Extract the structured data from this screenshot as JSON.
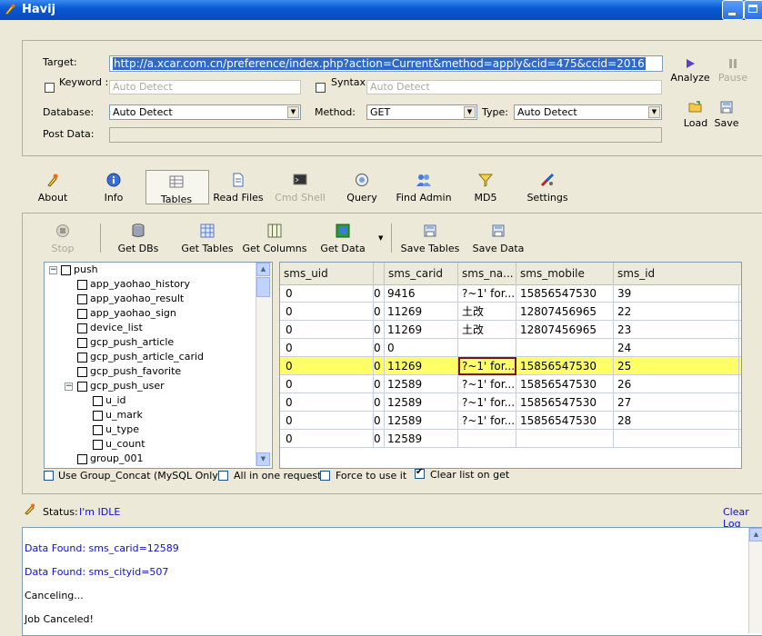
{
  "window": {
    "title": "Havij"
  },
  "target": {
    "target_label": "Target:",
    "url": "http://a.xcar.com.cn/preference/index.php?action=Current&method=apply&cid=475&ccid=2016",
    "keyword_label": "Keyword :",
    "keyword_placeholder": "Auto Detect",
    "syntax_label": "Syntax :",
    "syntax_placeholder": "Auto Detect",
    "database_label": "Database:",
    "database_value": "Auto Detect",
    "method_label": "Method:",
    "method_value": "GET",
    "type_label": "Type:",
    "type_value": "Auto Detect",
    "post_label": "Post Data:"
  },
  "side_buttons": {
    "analyze": "Analyze",
    "pause": "Pause",
    "load": "Load",
    "save": "Save"
  },
  "main_tabs": [
    {
      "label": "About",
      "icon": "about-icon"
    },
    {
      "label": "Info",
      "icon": "info-icon"
    },
    {
      "label": "Tables",
      "icon": "tables-icon"
    },
    {
      "label": "Read Files",
      "icon": "file-icon"
    },
    {
      "label": "Cmd Shell",
      "icon": "cmd-icon"
    },
    {
      "label": "Query",
      "icon": "query-icon"
    },
    {
      "label": "Find Admin",
      "icon": "admin-icon"
    },
    {
      "label": "MD5",
      "icon": "md5-icon"
    },
    {
      "label": "Settings",
      "icon": "settings-icon"
    }
  ],
  "toolbar": {
    "stop": "Stop",
    "get_dbs": "Get DBs",
    "get_tables": "Get Tables",
    "get_columns": "Get Columns",
    "get_data": "Get Data",
    "save_tables": "Save Tables",
    "save_data": "Save Data"
  },
  "tree": {
    "root": "push",
    "tables": [
      "app_yaohao_history",
      "app_yaohao_result",
      "app_yaohao_sign",
      "device_list",
      "gcp_push_article",
      "gcp_push_article_carid",
      "gcp_push_favorite",
      "gcp_push_user"
    ],
    "columns": [
      "u_id",
      "u_mark",
      "u_type",
      "u_count"
    ],
    "after": "group_001"
  },
  "grid": {
    "columns": [
      "sms_uid",
      "",
      "sms_carid",
      "sms_na...",
      "sms_mobile",
      "sms_id"
    ],
    "rows": [
      [
        "0",
        "0",
        "9416",
        "?~1' for...",
        "15856547530",
        "39"
      ],
      [
        "0",
        "0",
        "11269",
        "土改",
        "12807456965",
        "22"
      ],
      [
        "0",
        "0",
        "11269",
        "土改",
        "12807456965",
        "23"
      ],
      [
        "0",
        "0",
        "0",
        "",
        "",
        "24"
      ],
      [
        "0",
        "0",
        "11269",
        "?~1' for...",
        "15856547530",
        "25"
      ],
      [
        "0",
        "0",
        "12589",
        "?~1' for...",
        "15856547530",
        "26"
      ],
      [
        "0",
        "0",
        "12589",
        "?~1' for...",
        "15856547530",
        "27"
      ],
      [
        "0",
        "0",
        "12589",
        "?~1' for...",
        "15856547530",
        "28"
      ],
      [
        "0",
        "0",
        "12589",
        "",
        "",
        ""
      ]
    ]
  },
  "options": {
    "group_concat": "Use Group_Concat (MySQL Only)",
    "all_in_one": "All in one request.",
    "force": "Force to use it",
    "clear_list": "Clear list on get"
  },
  "status": {
    "label": "Status:",
    "value": "I'm IDLE",
    "clear_log": "Clear Log"
  },
  "log": [
    "Data Found: sms_carid=12589",
    "Data Found: sms_cityid=507",
    "Canceling...",
    "Job Canceled!"
  ],
  "colors": {
    "highlight_row": "#ffff66",
    "link_blue": "#1010c0",
    "selection": "#316ac5"
  }
}
